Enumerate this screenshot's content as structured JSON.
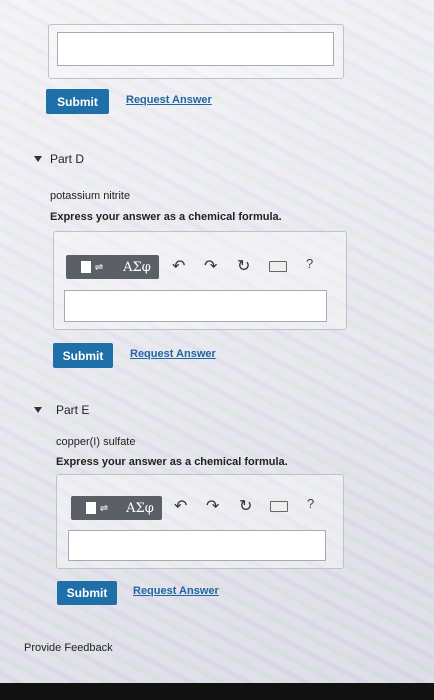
{
  "partC": {
    "submit_label": "Submit",
    "request_label": "Request Answer"
  },
  "partD": {
    "title": "Part D",
    "prompt": "potassium nitrite",
    "instruction": "Express your answer as a chemical formula.",
    "greek_label": "ΑΣφ",
    "help_label": "?",
    "submit_label": "Submit",
    "request_label": "Request Answer"
  },
  "partE": {
    "title": "Part E",
    "prompt": "copper(I) sulfate",
    "instruction": "Express your answer as a chemical formula.",
    "greek_label": "ΑΣφ",
    "help_label": "?",
    "submit_label": "Submit",
    "request_label": "Request Answer"
  },
  "footer": {
    "feedback_label": "Provide Feedback"
  },
  "colors": {
    "submit_bg": "#1f6fa8",
    "link": "#2166a0",
    "toolbar": "#5b6066"
  }
}
